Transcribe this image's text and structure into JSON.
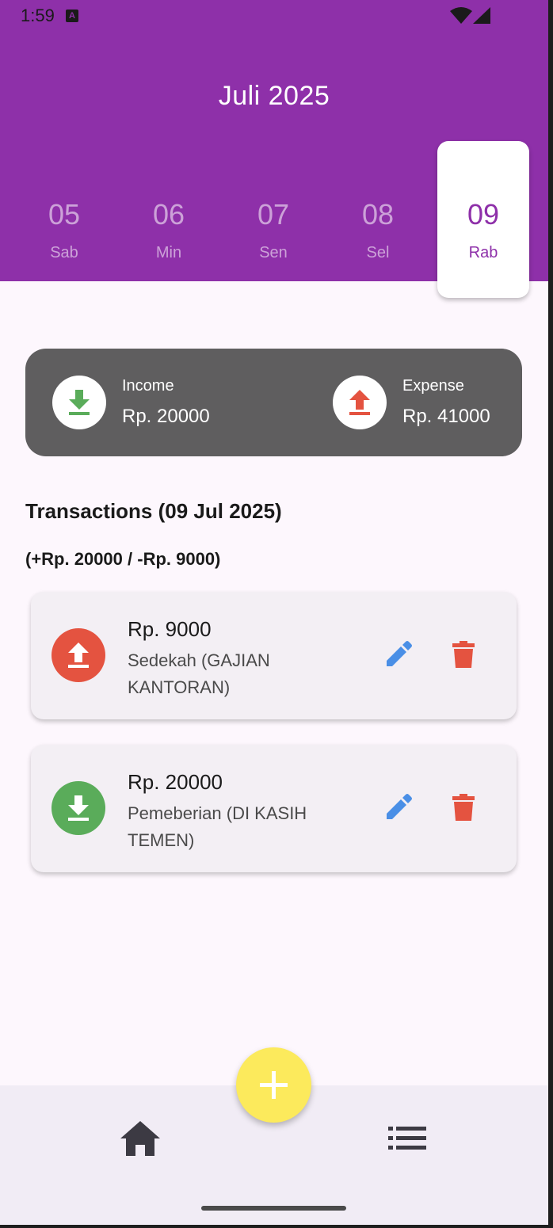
{
  "status_bar": {
    "time": "1:59",
    "notification_icon": "a-letter-icon",
    "icons": [
      "wifi-icon",
      "signal-icon"
    ]
  },
  "header": {
    "month_title": "Juli 2025"
  },
  "days": [
    {
      "number": "05",
      "name": "Sab",
      "selected": false
    },
    {
      "number": "06",
      "name": "Min",
      "selected": false
    },
    {
      "number": "07",
      "name": "Sen",
      "selected": false
    },
    {
      "number": "08",
      "name": "Sel",
      "selected": false
    },
    {
      "number": "09",
      "name": "Rab",
      "selected": true
    }
  ],
  "summary": {
    "income_label": "Income",
    "income_value": "Rp. 20000",
    "expense_label": "Expense",
    "expense_value": "Rp. 41000"
  },
  "transactions": {
    "title": "Transactions (09 Jul 2025)",
    "subtitle": "(+Rp. 20000 / -Rp. 9000)",
    "items": [
      {
        "type": "expense",
        "amount": "Rp. 9000",
        "description": "Sedekah (GAJIAN KANTORAN)"
      },
      {
        "type": "income",
        "amount": "Rp. 20000",
        "description": "Pemeberian (DI KASIH TEMEN)"
      }
    ]
  },
  "colors": {
    "header": "#8e30a9",
    "income": "#5aac5a",
    "expense": "#e45340",
    "edit": "#4a8fe6",
    "fab": "#fcea5c",
    "summary_card": "#5f5e5f"
  },
  "bottom_nav": {
    "items": [
      "home-icon",
      "list-icon"
    ],
    "fab_icon": "plus-icon"
  }
}
